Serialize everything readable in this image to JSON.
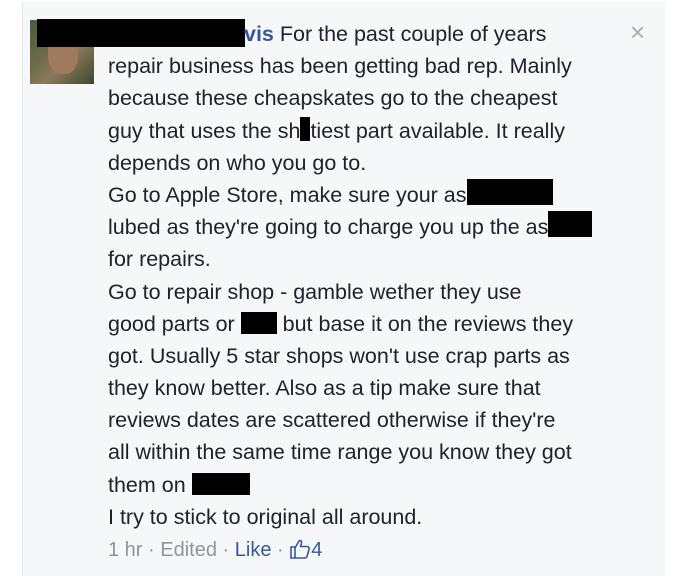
{
  "comment": {
    "author_suffix": "vis",
    "lines": [
      "For the past couple of years",
      "repair business has been getting bad rep. Mainly",
      "because these cheapskates go to the cheapest",
      [
        "guy that uses the sh",
        "tiest part available. It really"
      ],
      "depends on who you go to.",
      [
        "Go to Apple Store, make sure your as",
        ""
      ],
      [
        "lubed as they're going to charge you up the as",
        ""
      ],
      "for repairs.",
      "Go to repair shop - gamble wether they use",
      [
        "good parts or ",
        " but base it on the reviews they"
      ],
      "got. Usually 5 star shops won't use crap parts as",
      "they know better. Also as a tip make sure that",
      "reviews dates are scattered otherwise if they're",
      "all within the same time range you know they got",
      [
        "them on ",
        ""
      ],
      "I try to stick to original all around."
    ]
  },
  "close_icon": "×",
  "footer": {
    "time": "1 hr",
    "sep1": " · ",
    "edited": "Edited",
    "sep2": " · ",
    "like": "Like",
    "sep3": " · ",
    "like_count": "4"
  },
  "icons": {
    "close": "close-icon",
    "thumb": "thumbs-up-icon"
  }
}
